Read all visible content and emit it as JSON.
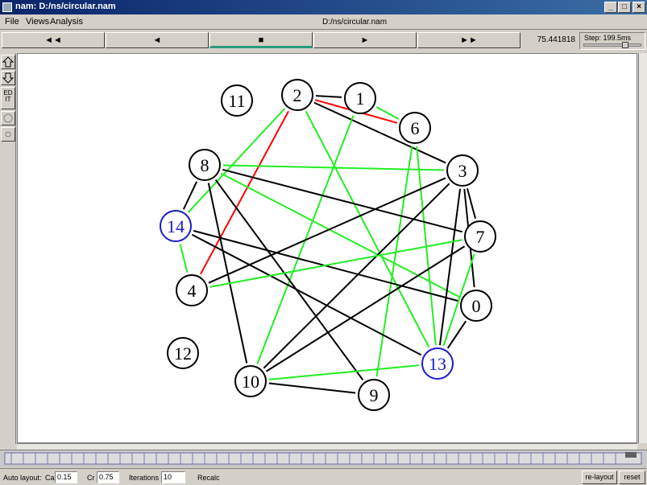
{
  "window": {
    "title": "nam: D:/ns/circular.nam",
    "controls": {
      "minimize": "_",
      "maximize": "□",
      "close": "×"
    }
  },
  "menu": {
    "file": "File",
    "views": "Views",
    "analysis": "Analysis",
    "file_path": "D:/ns/circular.nam"
  },
  "playback": {
    "rewind": "◄◄",
    "back": "◄",
    "stop": "■",
    "play": "►",
    "fast_forward": "►►",
    "time": "75.441818",
    "step": "Step: 199.5ms"
  },
  "left_tools": {
    "edit": "ED IT"
  },
  "nodes": [
    {
      "id": "11",
      "color": "#000000"
    },
    {
      "id": "2",
      "color": "#000000"
    },
    {
      "id": "1",
      "color": "#000000"
    },
    {
      "id": "6",
      "color": "#000000"
    },
    {
      "id": "8",
      "color": "#000000"
    },
    {
      "id": "3",
      "color": "#000000"
    },
    {
      "id": "14",
      "color": "#1a1acc"
    },
    {
      "id": "7",
      "color": "#000000"
    },
    {
      "id": "4",
      "color": "#000000"
    },
    {
      "id": "0",
      "color": "#000000"
    },
    {
      "id": "12",
      "color": "#000000"
    },
    {
      "id": "13",
      "color": "#1a1acc"
    },
    {
      "id": "10",
      "color": "#000000"
    },
    {
      "id": "9",
      "color": "#000000"
    }
  ],
  "links": [
    {
      "from": "2",
      "to": "1",
      "color": "#000000"
    },
    {
      "from": "2",
      "to": "6",
      "color": "#ff0000"
    },
    {
      "from": "2",
      "to": "3",
      "color": "#000000"
    },
    {
      "from": "1",
      "to": "6",
      "color": "#22ee22"
    },
    {
      "from": "2",
      "to": "14",
      "color": "#22ee22"
    },
    {
      "from": "2",
      "to": "4",
      "color": "#ff0000"
    },
    {
      "from": "2",
      "to": "13",
      "color": "#22ee22"
    },
    {
      "from": "1",
      "to": "10",
      "color": "#22ee22"
    },
    {
      "from": "6",
      "to": "13",
      "color": "#22ee22"
    },
    {
      "from": "6",
      "to": "9",
      "color": "#22ee22"
    },
    {
      "from": "8",
      "to": "3",
      "color": "#22ee22"
    },
    {
      "from": "8",
      "to": "7",
      "color": "#000000"
    },
    {
      "from": "8",
      "to": "0",
      "color": "#22ee22"
    },
    {
      "from": "8",
      "to": "14",
      "color": "#000000"
    },
    {
      "from": "8",
      "to": "10",
      "color": "#000000"
    },
    {
      "from": "8",
      "to": "9",
      "color": "#000000"
    },
    {
      "from": "3",
      "to": "7",
      "color": "#000000"
    },
    {
      "from": "3",
      "to": "13",
      "color": "#000000"
    },
    {
      "from": "3",
      "to": "4",
      "color": "#000000"
    },
    {
      "from": "3",
      "to": "10",
      "color": "#000000"
    },
    {
      "from": "3",
      "to": "0",
      "color": "#000000"
    },
    {
      "from": "14",
      "to": "0",
      "color": "#000000"
    },
    {
      "from": "14",
      "to": "13",
      "color": "#000000"
    },
    {
      "from": "14",
      "to": "4",
      "color": "#22ee22"
    },
    {
      "from": "7",
      "to": "4",
      "color": "#22ee22"
    },
    {
      "from": "7",
      "to": "10",
      "color": "#000000"
    },
    {
      "from": "7",
      "to": "13",
      "color": "#22ee22"
    },
    {
      "from": "0",
      "to": "13",
      "color": "#000000"
    },
    {
      "from": "10",
      "to": "13",
      "color": "#22ee22"
    },
    {
      "from": "10",
      "to": "9",
      "color": "#000000"
    }
  ],
  "status": {
    "auto_layout": "Auto layout:",
    "ca_label": "Ca",
    "ca_value": "0.15",
    "cr_label": "Cr",
    "cr_value": "0.75",
    "iterations_label": "Iterations",
    "iterations_value": "10",
    "recalc": "Recalc",
    "relayout": "re-layout",
    "reset": "reset"
  }
}
